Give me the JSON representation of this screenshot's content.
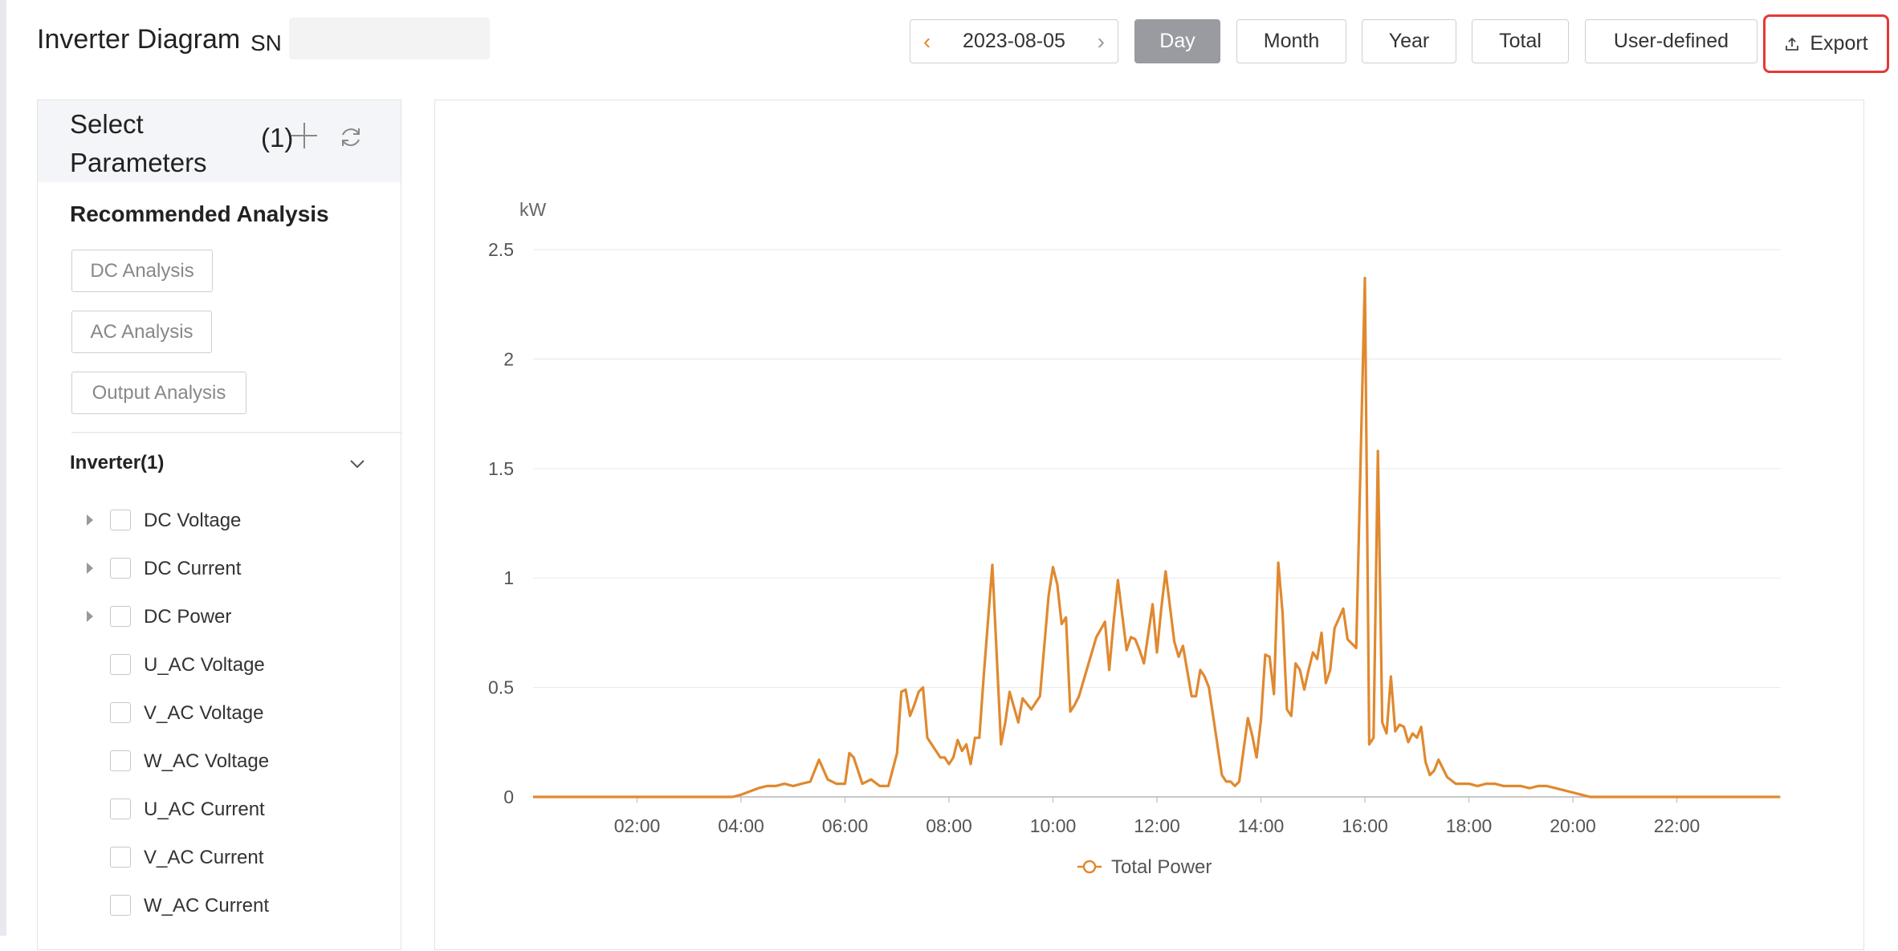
{
  "header": {
    "title": "Inverter Diagram",
    "sn_label": "SN",
    "date": "2023-08-05",
    "prev_icon": "chevron-left-icon",
    "next_icon": "chevron-right-icon",
    "period_buttons": {
      "day": "Day",
      "month": "Month",
      "year": "Year",
      "total": "Total",
      "user_defined": "User-defined"
    },
    "active_period": "Day",
    "export_label": "Export",
    "export_icon": "upload-icon"
  },
  "sidebar": {
    "title": "Select Parameters",
    "count": "(1)",
    "recommended_title": "Recommended Analysis",
    "recommended": [
      "DC Analysis",
      "AC Analysis",
      "Output Analysis"
    ],
    "group_title": "Inverter(1)",
    "params": [
      {
        "label": "DC Voltage",
        "expandable": true
      },
      {
        "label": "DC Current",
        "expandable": true
      },
      {
        "label": "DC Power",
        "expandable": true
      },
      {
        "label": "U_AC Voltage",
        "expandable": false
      },
      {
        "label": "V_AC Voltage",
        "expandable": false
      },
      {
        "label": "W_AC Voltage",
        "expandable": false
      },
      {
        "label": "U_AC Current",
        "expandable": false
      },
      {
        "label": "V_AC Current",
        "expandable": false
      },
      {
        "label": "W_AC Current",
        "expandable": false
      }
    ]
  },
  "colors": {
    "series": "#e0892f",
    "grid": "#ececec",
    "active_button": "#999ba0",
    "highlight": "#e53935"
  },
  "chart_data": {
    "type": "line",
    "unit_label": "kW",
    "ylim": [
      0,
      2.5
    ],
    "yticks": [
      "0",
      "0.5",
      "1",
      "1.5",
      "2",
      "2.5"
    ],
    "xlim_hours": [
      0,
      24
    ],
    "xticks": [
      "02:00",
      "04:00",
      "06:00",
      "08:00",
      "10:00",
      "12:00",
      "14:00",
      "16:00",
      "18:00",
      "20:00",
      "22:00"
    ],
    "grid": true,
    "legend_position": "bottom-center",
    "series": [
      {
        "name": "Total Power",
        "points": [
          [
            "00:00",
            0
          ],
          [
            "03:00",
            0
          ],
          [
            "03:50",
            0
          ],
          [
            "04:00",
            0.01
          ],
          [
            "04:20",
            0.04
          ],
          [
            "04:30",
            0.05
          ],
          [
            "04:40",
            0.05
          ],
          [
            "04:50",
            0.06
          ],
          [
            "05:00",
            0.05
          ],
          [
            "05:10",
            0.06
          ],
          [
            "05:20",
            0.07
          ],
          [
            "05:30",
            0.17
          ],
          [
            "05:40",
            0.08
          ],
          [
            "05:50",
            0.06
          ],
          [
            "06:00",
            0.06
          ],
          [
            "06:05",
            0.2
          ],
          [
            "06:10",
            0.18
          ],
          [
            "06:15",
            0.12
          ],
          [
            "06:20",
            0.06
          ],
          [
            "06:30",
            0.08
          ],
          [
            "06:40",
            0.05
          ],
          [
            "06:50",
            0.05
          ],
          [
            "07:00",
            0.2
          ],
          [
            "07:05",
            0.48
          ],
          [
            "07:10",
            0.49
          ],
          [
            "07:15",
            0.37
          ],
          [
            "07:20",
            0.42
          ],
          [
            "07:25",
            0.48
          ],
          [
            "07:30",
            0.5
          ],
          [
            "07:35",
            0.27
          ],
          [
            "07:40",
            0.24
          ],
          [
            "07:50",
            0.18
          ],
          [
            "07:55",
            0.18
          ],
          [
            "08:00",
            0.15
          ],
          [
            "08:05",
            0.18
          ],
          [
            "08:10",
            0.26
          ],
          [
            "08:15",
            0.21
          ],
          [
            "08:20",
            0.24
          ],
          [
            "08:25",
            0.15
          ],
          [
            "08:30",
            0.27
          ],
          [
            "08:35",
            0.27
          ],
          [
            "08:40",
            0.55
          ],
          [
            "08:50",
            1.06
          ],
          [
            "08:55",
            0.65
          ],
          [
            "09:00",
            0.24
          ],
          [
            "09:05",
            0.34
          ],
          [
            "09:10",
            0.48
          ],
          [
            "09:20",
            0.34
          ],
          [
            "09:25",
            0.45
          ],
          [
            "09:35",
            0.4
          ],
          [
            "09:45",
            0.46
          ],
          [
            "09:55",
            0.92
          ],
          [
            "10:00",
            1.05
          ],
          [
            "10:05",
            0.97
          ],
          [
            "10:10",
            0.79
          ],
          [
            "10:15",
            0.82
          ],
          [
            "10:20",
            0.39
          ],
          [
            "10:25",
            0.42
          ],
          [
            "10:30",
            0.46
          ],
          [
            "10:50",
            0.73
          ],
          [
            "11:00",
            0.8
          ],
          [
            "11:05",
            0.58
          ],
          [
            "11:10",
            0.8
          ],
          [
            "11:15",
            0.99
          ],
          [
            "11:25",
            0.67
          ],
          [
            "11:30",
            0.73
          ],
          [
            "11:35",
            0.72
          ],
          [
            "11:40",
            0.67
          ],
          [
            "11:45",
            0.61
          ],
          [
            "11:55",
            0.88
          ],
          [
            "12:00",
            0.66
          ],
          [
            "12:05",
            0.86
          ],
          [
            "12:10",
            1.03
          ],
          [
            "12:15",
            0.87
          ],
          [
            "12:20",
            0.71
          ],
          [
            "12:25",
            0.64
          ],
          [
            "12:30",
            0.69
          ],
          [
            "12:40",
            0.46
          ],
          [
            "12:45",
            0.46
          ],
          [
            "12:50",
            0.58
          ],
          [
            "12:55",
            0.55
          ],
          [
            "13:00",
            0.5
          ],
          [
            "13:15",
            0.1
          ],
          [
            "13:20",
            0.07
          ],
          [
            "13:25",
            0.07
          ],
          [
            "13:30",
            0.05
          ],
          [
            "13:35",
            0.07
          ],
          [
            "13:45",
            0.36
          ],
          [
            "13:50",
            0.28
          ],
          [
            "13:55",
            0.18
          ],
          [
            "14:00",
            0.35
          ],
          [
            "14:05",
            0.65
          ],
          [
            "14:10",
            0.64
          ],
          [
            "14:15",
            0.47
          ],
          [
            "14:20",
            1.07
          ],
          [
            "14:25",
            0.84
          ],
          [
            "14:30",
            0.4
          ],
          [
            "14:35",
            0.37
          ],
          [
            "14:40",
            0.61
          ],
          [
            "14:45",
            0.58
          ],
          [
            "14:50",
            0.49
          ],
          [
            "14:55",
            0.58
          ],
          [
            "15:00",
            0.66
          ],
          [
            "15:05",
            0.63
          ],
          [
            "15:10",
            0.75
          ],
          [
            "15:15",
            0.52
          ],
          [
            "15:20",
            0.58
          ],
          [
            "15:25",
            0.77
          ],
          [
            "15:35",
            0.86
          ],
          [
            "15:40",
            0.72
          ],
          [
            "15:45",
            0.7
          ],
          [
            "15:50",
            0.68
          ],
          [
            "16:00",
            2.37
          ],
          [
            "16:05",
            0.24
          ],
          [
            "16:10",
            0.27
          ],
          [
            "16:15",
            1.58
          ],
          [
            "16:20",
            0.34
          ],
          [
            "16:25",
            0.29
          ],
          [
            "16:30",
            0.55
          ],
          [
            "16:35",
            0.3
          ],
          [
            "16:40",
            0.33
          ],
          [
            "16:45",
            0.32
          ],
          [
            "16:50",
            0.25
          ],
          [
            "16:55",
            0.29
          ],
          [
            "17:00",
            0.27
          ],
          [
            "17:05",
            0.32
          ],
          [
            "17:10",
            0.16
          ],
          [
            "17:15",
            0.1
          ],
          [
            "17:20",
            0.12
          ],
          [
            "17:25",
            0.17
          ],
          [
            "17:35",
            0.09
          ],
          [
            "17:45",
            0.06
          ],
          [
            "18:00",
            0.06
          ],
          [
            "18:10",
            0.05
          ],
          [
            "18:20",
            0.06
          ],
          [
            "18:30",
            0.06
          ],
          [
            "18:40",
            0.05
          ],
          [
            "18:50",
            0.05
          ],
          [
            "19:00",
            0.05
          ],
          [
            "19:10",
            0.04
          ],
          [
            "19:20",
            0.05
          ],
          [
            "19:30",
            0.05
          ],
          [
            "19:40",
            0.04
          ],
          [
            "19:50",
            0.03
          ],
          [
            "20:00",
            0.02
          ],
          [
            "20:10",
            0.01
          ],
          [
            "20:20",
            0.0
          ],
          [
            "21:00",
            0
          ],
          [
            "22:00",
            0
          ],
          [
            "23:59",
            0
          ]
        ]
      }
    ]
  }
}
